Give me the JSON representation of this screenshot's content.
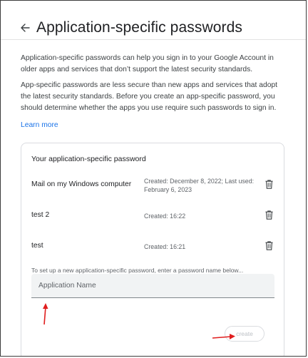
{
  "header": {
    "back_icon": "arrow-back-icon",
    "title": "Application-specific passwords"
  },
  "intro": {
    "paragraph1": "Application-specific passwords can help you sign in to your Google Account in older apps and services that don’t support the latest security standards.",
    "paragraph2": "App-specific passwords are less secure than new apps and services that adopt the latest security standards. Before you create an app-specific password, you should determine whether the apps you use require such passwords to sign in.",
    "learn_more": "Learn more"
  },
  "card": {
    "title": "Your application-specific password",
    "passwords": [
      {
        "name": "Mail on my Windows computer",
        "meta": "Created: December 8, 2022; Last used: February 6, 2023",
        "icon": "trash-icon"
      },
      {
        "name": "test 2",
        "meta": "Created: 16:22",
        "icon": "trash-icon"
      },
      {
        "name": "test",
        "meta": "Created: 16:21",
        "icon": "trash-icon"
      }
    ],
    "hint": "To set up a new application-specific password, enter a password name below...",
    "name_input": {
      "placeholder": "Application Name",
      "value": ""
    },
    "create_label": "create"
  },
  "annotations": {
    "arrow_color": "#e01e1e"
  },
  "colors": {
    "link": "#1a73e8",
    "text": "#3c4043",
    "border": "#dadce0"
  }
}
